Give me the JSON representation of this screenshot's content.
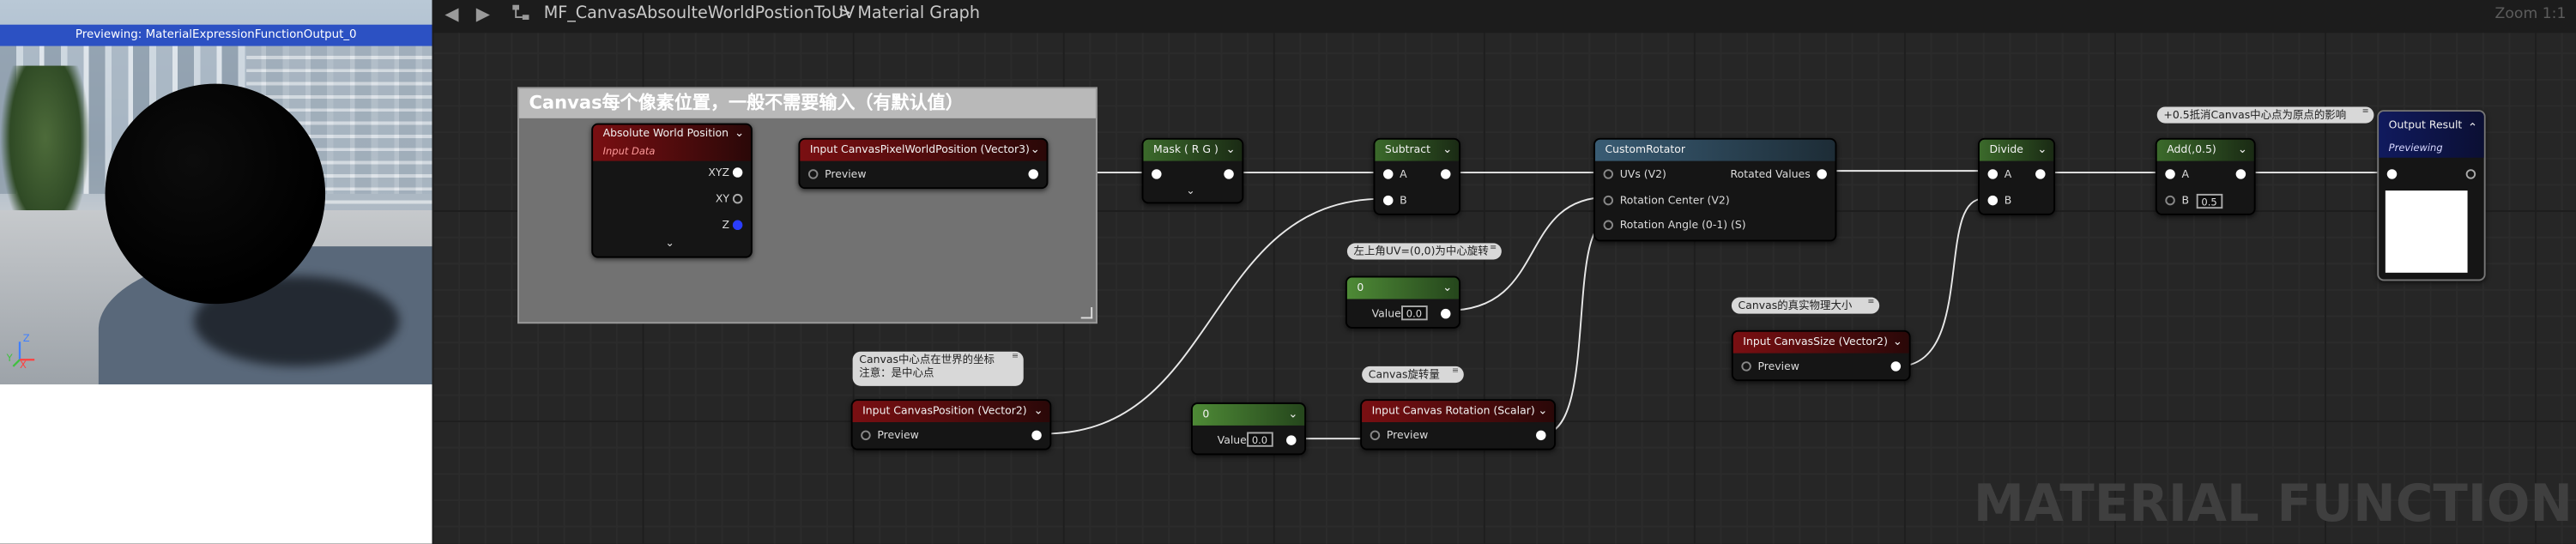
{
  "viewport": {
    "title": "Previewing: MaterialExpressionFunctionOutput_0",
    "axes": {
      "z": "Z",
      "y": "Y",
      "x": "X"
    }
  },
  "topbar": {
    "back_icon": "arrow-left-icon",
    "forward_icon": "arrow-right-icon",
    "graph_icon": "graph-icon",
    "breadcrumb_asset": "MF_CanvasAbsoulteWorldPostionToUV",
    "breadcrumb_sep": ">",
    "breadcrumb_graph": "Material Graph",
    "zoom": "Zoom 1:1"
  },
  "comment": {
    "title": "Canvas每个像素位置，一般不需要输入（有默认值）"
  },
  "nodes": {
    "absolute_world_position": {
      "title": "Absolute World Position",
      "subtitle": "Input Data",
      "pins": [
        "XYZ",
        "XY",
        "Z"
      ]
    },
    "input_canvas_pixel_world_position": {
      "title": "Input CanvasPixelWorldPosition (Vector3)",
      "preview": "Preview"
    },
    "mask": {
      "title": "Mask ( R G )"
    },
    "subtract": {
      "title": "Subtract",
      "a": "A",
      "b": "B"
    },
    "custom_rotator": {
      "title": "CustomRotator",
      "uvs": "UVs (V2)",
      "rotation_center": "Rotation Center (V2)",
      "rotation_angle": "Rotation Angle (0-1) (S)",
      "output": "Rotated Values"
    },
    "divide": {
      "title": "Divide",
      "a": "A",
      "b": "B"
    },
    "add": {
      "title": "Add(,0.5)",
      "a": "A",
      "b_label": "B",
      "b_value": "0.5"
    },
    "output_result": {
      "title": "Output Result",
      "subtitle": "Previewing"
    },
    "constant_center": {
      "title": "0",
      "value_label": "Value",
      "value": "0.0"
    },
    "constant_bottom": {
      "title": "0",
      "value_label": "Value",
      "value": "0.0"
    },
    "input_canvas_position": {
      "title": "Input CanvasPosition (Vector2)",
      "preview": "Preview"
    },
    "input_canvas_rotation": {
      "title": "Input Canvas Rotation (Scalar)",
      "preview": "Preview"
    },
    "input_canvas_size": {
      "title": "Input CanvasSize (Vector2)",
      "preview": "Preview"
    }
  },
  "bubbles": {
    "top_left_uv": "左上角UV=(0,0)为中心旋转",
    "canvas_position_line1": "Canvas中心点在世界的坐标",
    "canvas_position_line2": "注意：是中心点",
    "canvas_rotation": "Canvas旋转量",
    "canvas_size": "Canvas的真实物理大小",
    "add_note": "+0.5抵消Canvas中心点为原点的影响"
  },
  "watermark": "MATERIAL FUNCTION",
  "colors": {
    "viewport_title_bar": "#2c51c3",
    "input_header": "#7a0f12",
    "math_header": "#3b6a2b",
    "function_header": "#395c74",
    "output_header": "#101a5e"
  }
}
